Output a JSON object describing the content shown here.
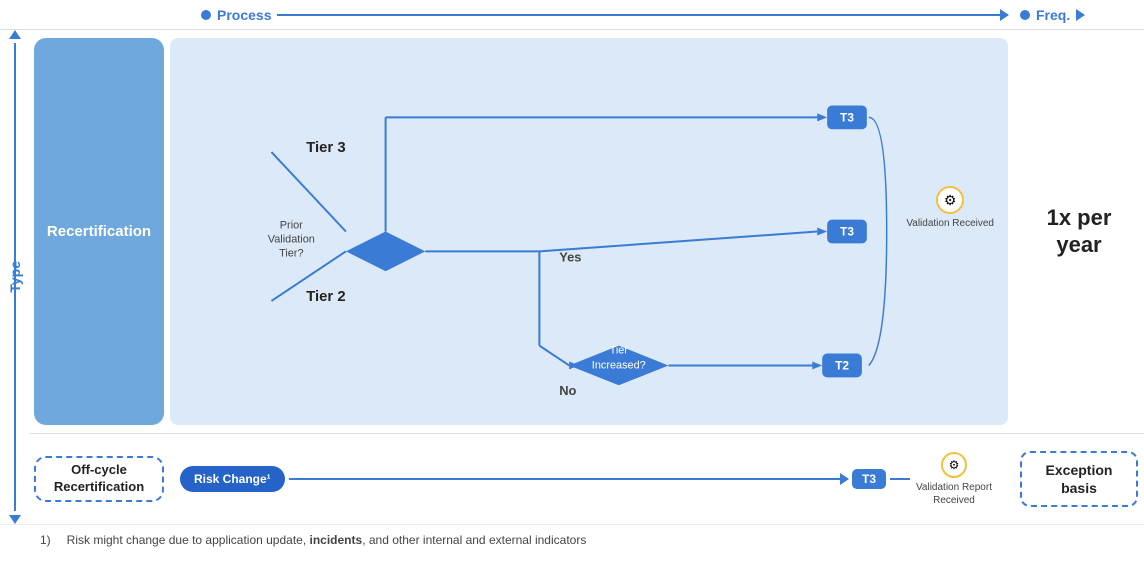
{
  "header": {
    "process_label": "Process",
    "freq_label": "Freq."
  },
  "type_label": "Type",
  "recertification": {
    "label": "Recertification",
    "freq": "1x per\nyear",
    "tiers": {
      "tier3_label": "Tier 3",
      "tier2_label": "Tier 2",
      "yes_label": "Yes",
      "no_label": "No",
      "prior_validation_label": "Prior\nValidation\nTier?",
      "tier_increased_label": "Tier\nIncreased?",
      "validation_received_label": "Validation\nReceived",
      "t3_badge": "T3",
      "t2_badge": "T2"
    }
  },
  "offcycle": {
    "label": "Off-cycle\nRecertification",
    "risk_change_label": "Risk Change¹",
    "validation_report_label": "Validation Report\nReceived",
    "exception_label": "Exception\nbasis",
    "t3_badge": "T3"
  },
  "footnote": {
    "number": "1)",
    "text": "Risk might change due to application update, ",
    "bold": "incidents",
    "text2": ", and other internal and external indicators"
  }
}
